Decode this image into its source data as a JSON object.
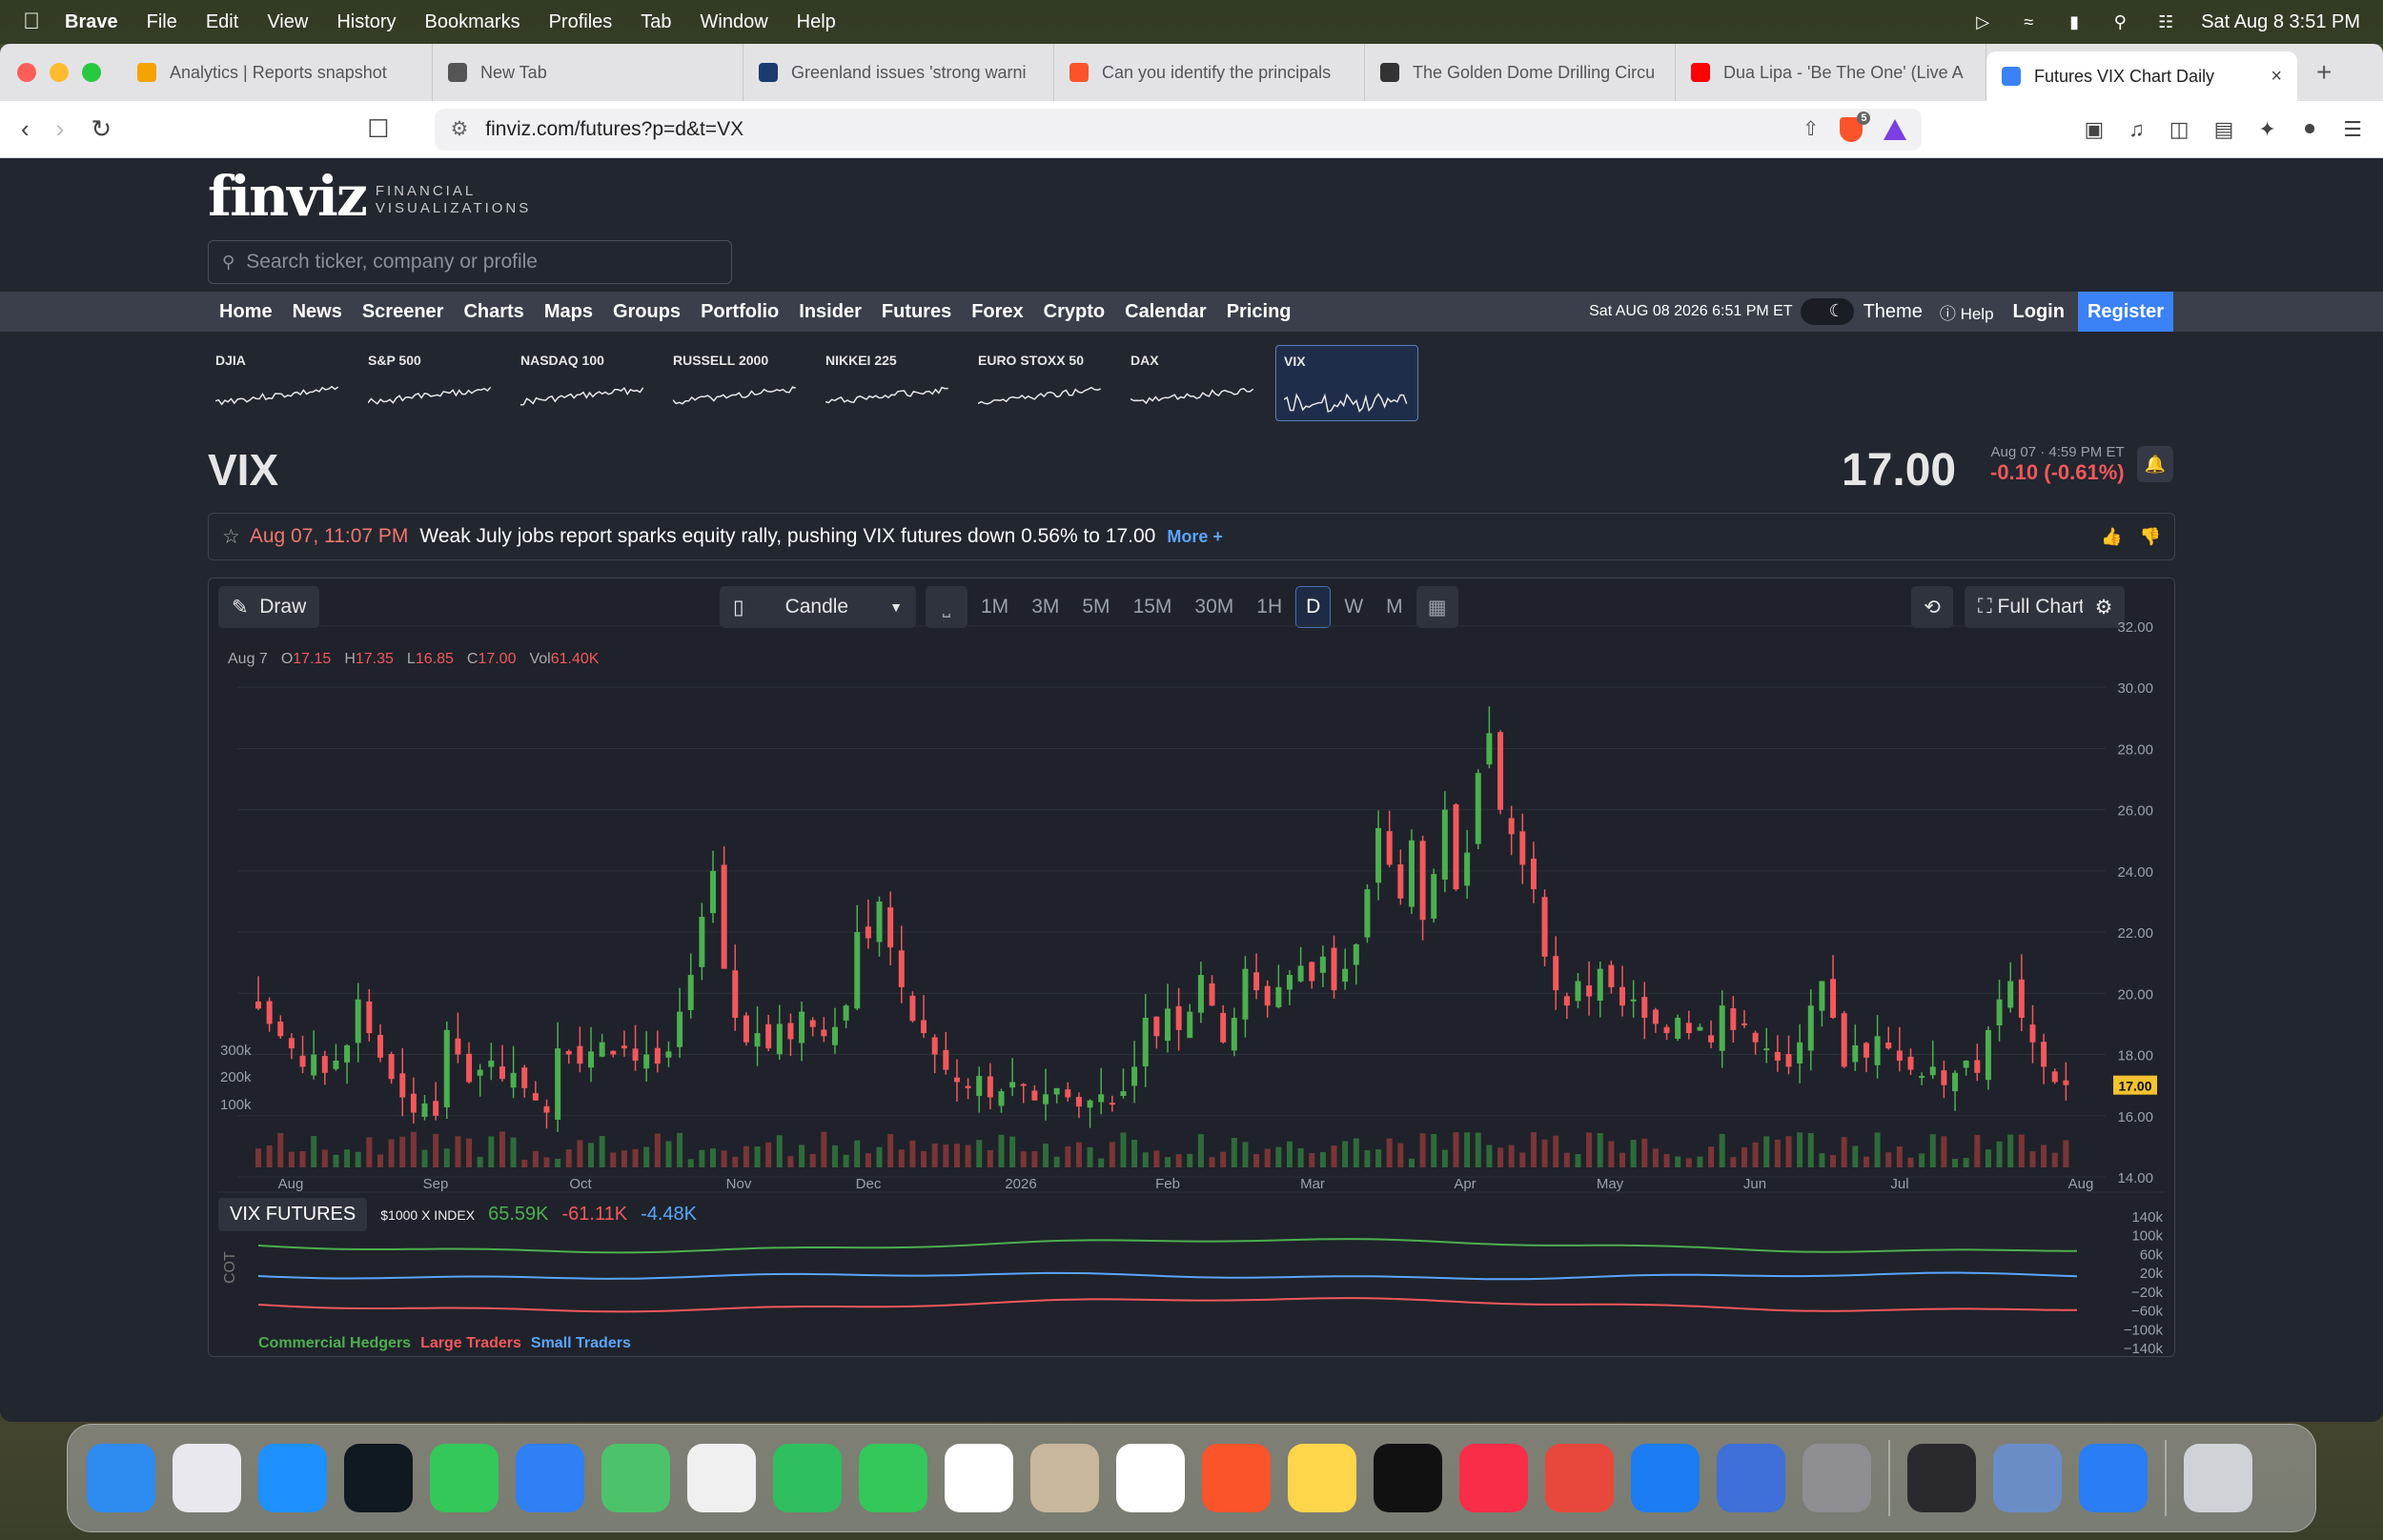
{
  "menubar": {
    "app": "Brave",
    "items": [
      "File",
      "Edit",
      "View",
      "History",
      "Bookmarks",
      "Profiles",
      "Tab",
      "Window",
      "Help"
    ],
    "clock": "Sat Aug 8  3:51 PM"
  },
  "tabs": [
    {
      "title": "Analytics | Reports snapshot",
      "color": "#f4a300"
    },
    {
      "title": "New Tab",
      "color": "#555555"
    },
    {
      "title": "Greenland issues 'strong warni",
      "color": "#1b3b6f"
    },
    {
      "title": "Can you identify the principals",
      "color": "#fb542b"
    },
    {
      "title": "The Golden Dome Drilling Circu",
      "color": "#333333"
    },
    {
      "title": "Dua Lipa - 'Be The One' (Live A",
      "color": "#ff0000"
    },
    {
      "title": "Futures VIX Chart Daily",
      "color": "#3b82f6",
      "active": true
    }
  ],
  "url": "finviz.com/futures?p=d&t=VX",
  "finviz": {
    "logo": "finviz",
    "logo_sub1": "FINANCIAL",
    "logo_sub2": "VISUALIZATIONS",
    "search_placeholder": "Search ticker, company or profile",
    "nav": [
      "Home",
      "News",
      "Screener",
      "Charts",
      "Maps",
      "Groups",
      "Portfolio",
      "Insider",
      "Futures",
      "Forex",
      "Crypto",
      "Calendar",
      "Pricing"
    ],
    "datetime": "Sat AUG 08 2026 6:51 PM ET",
    "theme": "Theme",
    "help": "Help",
    "login": "Login",
    "register": "Register"
  },
  "minis": [
    "DJIA",
    "S&P 500",
    "NASDAQ 100",
    "RUSSELL 2000",
    "NIKKEI 225",
    "EURO STOXX 50",
    "DAX",
    "VIX"
  ],
  "quote": {
    "ticker": "VIX",
    "price": "17.00",
    "time": "Aug 07 · 4:59 PM ET",
    "change": "-0.10 (-0.61%)"
  },
  "news": {
    "when": "Aug 07, 11:07 PM",
    "headline": "Weak July jobs report sparks equity rally, pushing VIX futures down 0.56% to 17.00",
    "more": "More +"
  },
  "chart_toolbar": {
    "draw": "Draw",
    "type": "Candle",
    "timeframes": [
      "1M",
      "3M",
      "5M",
      "15M",
      "30M",
      "1H",
      "D",
      "W",
      "M"
    ],
    "active_tf": "D",
    "full_chart": "Full Chart"
  },
  "ohlc": {
    "date": "Aug 7",
    "o": "17.15",
    "h": "17.35",
    "l": "16.85",
    "c": "17.00",
    "vol": "61.40K"
  },
  "cot": {
    "name": "VIX FUTURES",
    "mult": "$1000 X INDEX",
    "g": "65.59K",
    "r": "-61.11K",
    "b": "-4.48K",
    "label": "COT",
    "legend": [
      "Commercial Hedgers",
      "Large Traders",
      "Small Traders"
    ]
  },
  "chart_data": {
    "type": "candlestick",
    "y_ticks": [
      "32.00",
      "30.00",
      "28.00",
      "26.00",
      "24.00",
      "22.00",
      "20.00",
      "18.00",
      "16.00",
      "14.00"
    ],
    "ylim": [
      14,
      32
    ],
    "x_ticks": [
      "Aug",
      "Sep",
      "Oct",
      "Nov",
      "Dec",
      "2026",
      "Feb",
      "Mar",
      "Apr",
      "May",
      "Jun",
      "Jul",
      "Aug"
    ],
    "last_price_label": "17.00",
    "volume_ticks": [
      "300k",
      "200k",
      "100k"
    ],
    "cot_ticks": [
      "140k",
      "100k",
      "60k",
      "20k",
      "−20k",
      "−60k",
      "−100k",
      "−140k"
    ],
    "close_series": [
      19.5,
      19.0,
      18.6,
      18.2,
      17.6,
      18.0,
      17.4,
      17.8,
      18.3,
      19.8,
      18.7,
      17.9,
      17.2,
      16.6,
      16.1,
      16.4,
      16.0,
      18.8,
      18.0,
      17.1,
      17.5,
      17.8,
      17.2,
      17.4,
      16.9,
      16.5,
      16.1,
      18.2,
      18.0,
      17.7,
      18.1,
      18.4,
      18.0,
      18.2,
      17.8,
      18.0,
      17.7,
      18.1,
      19.4,
      20.6,
      22.5,
      24.0,
      20.8,
      19.2,
      18.4,
      18.7,
      18.2,
      19.0,
      18.5,
      19.4,
      18.9,
      18.6,
      18.9,
      19.6,
      22.0,
      21.8,
      23.0,
      21.5,
      20.2,
      19.1,
      18.7,
      18.0,
      17.5,
      17.1,
      16.9,
      17.3,
      16.6,
      16.8,
      17.1,
      17.0,
      16.5,
      16.7,
      16.9,
      16.6,
      16.3,
      16.5,
      16.7,
      16.4,
      16.8,
      17.6,
      19.2,
      18.6,
      19.5,
      18.8,
      19.4,
      20.6,
      19.6,
      18.4,
      19.2,
      20.8,
      20.1,
      19.6,
      20.2,
      20.6,
      20.9,
      20.4,
      21.2,
      20.1,
      20.8,
      21.6,
      23.4,
      25.4,
      24.2,
      23.1,
      25.0,
      22.4,
      23.9,
      26.0,
      23.4,
      24.6,
      27.2,
      28.5,
      26.0,
      25.2,
      24.2,
      23.4,
      21.2,
      20.1,
      19.6,
      20.4,
      19.9,
      20.8,
      20.2,
      19.6,
      19.8,
      19.2,
      19.0,
      18.7,
      19.2,
      18.7,
      18.9,
      18.4,
      19.6,
      18.8,
      19.0,
      18.4,
      18.2,
      17.8,
      17.6,
      18.4,
      19.6,
      20.4,
      19.2,
      17.6,
      18.3,
      17.9,
      18.6,
      18.2,
      17.8,
      17.5,
      17.3,
      17.6,
      17.0,
      17.4,
      17.8,
      17.4,
      18.8,
      19.8,
      20.4,
      19.2,
      18.4,
      17.6,
      17.1,
      17.0
    ]
  }
}
